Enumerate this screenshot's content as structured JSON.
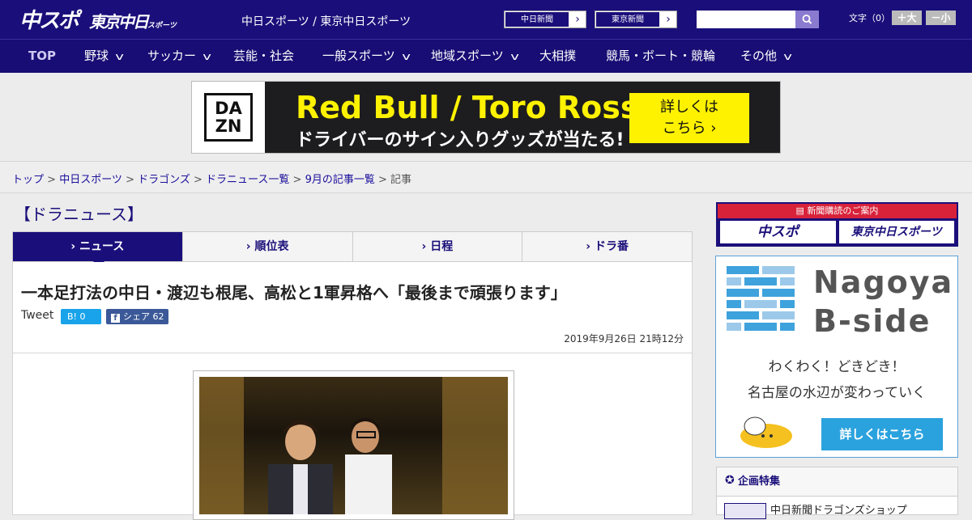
{
  "header": {
    "logo_main": "中スポ",
    "logo_tokyo": "東京中日",
    "logo_tokyo_suffix": "スポーツ",
    "site_link_1": "中日スポーツ",
    "site_separator": " / ",
    "site_link_2": "東京中日スポーツ",
    "paper_btn_1": "中日新聞",
    "paper_btn_2": "東京新聞",
    "search_placeholder": "",
    "font_size_label": "文字（0）",
    "font_plus": "＋大",
    "font_minus": "－小",
    "colors": {
      "navy": "#1a0f7a",
      "accent_red": "#d8223a"
    }
  },
  "nav": {
    "items": [
      {
        "label": "TOP",
        "dropdown": false
      },
      {
        "label": "野球",
        "dropdown": true
      },
      {
        "label": "サッカー",
        "dropdown": true
      },
      {
        "label": "芸能・社会",
        "dropdown": false
      },
      {
        "label": "一般スポーツ",
        "dropdown": true
      },
      {
        "label": "地域スポーツ",
        "dropdown": true
      },
      {
        "label": "大相撲",
        "dropdown": false
      },
      {
        "label": "競馬・ボート・競輪",
        "dropdown": false
      },
      {
        "label": "その他",
        "dropdown": true
      }
    ]
  },
  "ad": {
    "brand_top": "DA",
    "brand_bottom": "ZN",
    "title": "Red Bull / Toro Rosso",
    "subtitle": "ドライバーのサイン入りグッズが当たる!",
    "cta_line1": "詳しくは",
    "cta_line2": "こちら ›"
  },
  "breadcrumb": {
    "items": [
      "トップ",
      "中日スポーツ",
      "ドラゴンズ",
      "ドラニュース一覧",
      "9月の記事一覧"
    ],
    "separator": " > ",
    "current": "記事"
  },
  "section_title": "【ドラニュース】",
  "tabs": [
    "ニュース",
    "順位表",
    "日程",
    "ドラ番"
  ],
  "article": {
    "headline": "一本足打法の中日・渡辺も根尾、高松と1軍昇格へ「最後まで頑張ります」",
    "tweet": "Tweet",
    "hatena": "B! 0",
    "fb_label": "シェア",
    "fb_count": "62",
    "date": "2019年9月26日 21時12分"
  },
  "sidebar": {
    "subscribe_title": "新聞購読のご案内",
    "subscribe_logo_1": "中スポ",
    "subscribe_logo_2": "東京中日スポーツ",
    "nagoya_line1": "Nagoya",
    "nagoya_line2": "B-side",
    "nagoya_tag1": "わくわく！どきどき！",
    "nagoya_tag2": "名古屋の水辺が変わっていく",
    "nagoya_button": "詳しくはこちら",
    "feature_title": "企画特集",
    "feature_item": "中日新聞ドラゴンズショップ"
  }
}
